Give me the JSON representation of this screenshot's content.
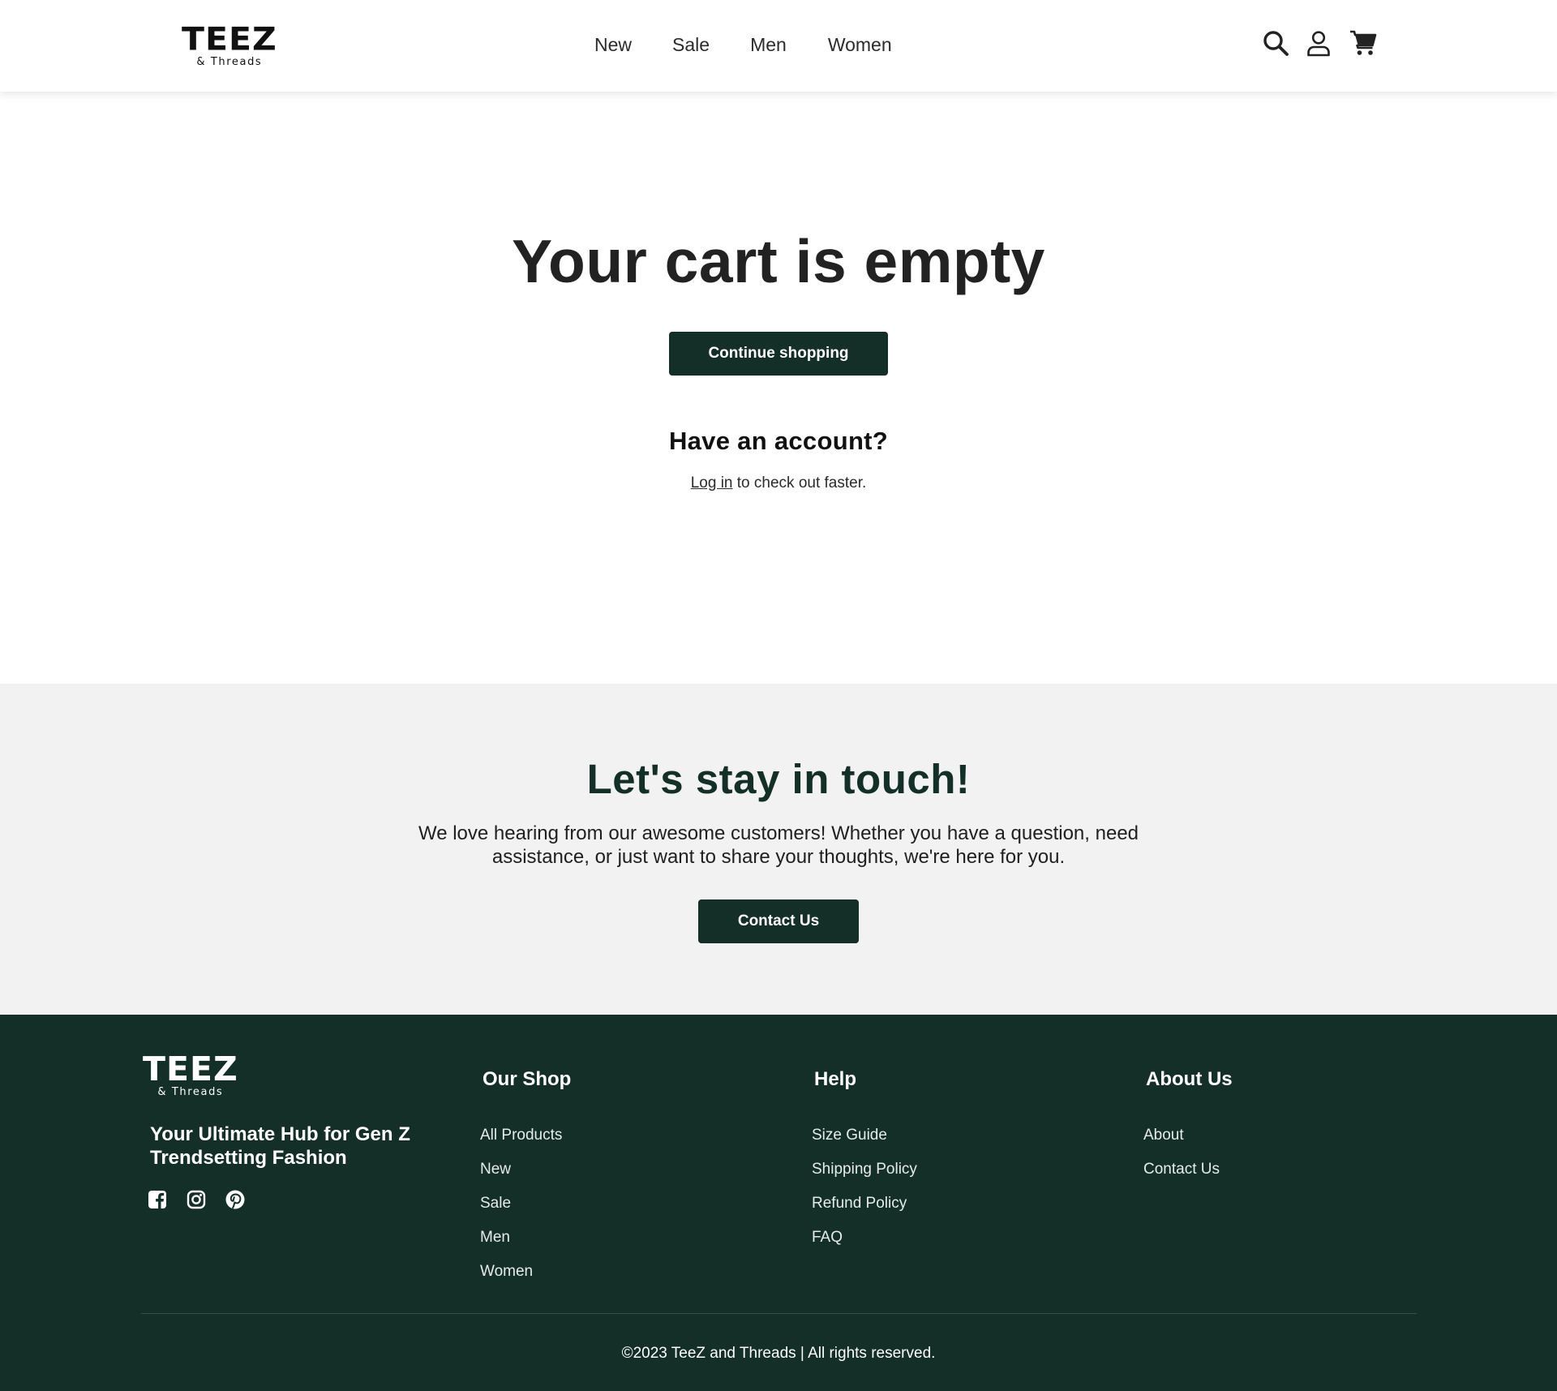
{
  "header": {
    "logo": {
      "brand": "TEEZ",
      "sub": "& Threads"
    },
    "nav": [
      "New",
      "Sale",
      "Men",
      "Women"
    ],
    "icons": [
      "search-icon",
      "account-icon",
      "cart-icon"
    ]
  },
  "main": {
    "title": "Your cart is empty",
    "continue_label": "Continue shopping",
    "account_title": "Have an account?",
    "login_link": "Log in",
    "login_suffix": " to check out faster."
  },
  "touch": {
    "title": "Let's stay in touch!",
    "text": "We love hearing from our awesome customers! Whether you have a question, need assistance, or just want to share your thoughts, we're here for you.",
    "contact_label": "Contact Us"
  },
  "footer": {
    "logo": {
      "brand": "TEEZ",
      "sub": "& Threads"
    },
    "tagline": "Your Ultimate Hub for Gen Z Trendsetting Fashion",
    "socials": [
      "facebook-icon",
      "instagram-icon",
      "pinterest-icon"
    ],
    "columns": [
      {
        "title": "Our Shop",
        "links": [
          "All Products",
          "New",
          "Sale",
          "Men",
          "Women"
        ]
      },
      {
        "title": "Help",
        "links": [
          "Size Guide",
          "Shipping Policy",
          "Refund Policy",
          "FAQ"
        ]
      },
      {
        "title": "About Us",
        "links": [
          "About",
          "Contact Us"
        ]
      }
    ],
    "copyright": "©2023 TeeZ and Threads | All rights reserved."
  },
  "colors": {
    "primary": "#142f27",
    "touch_bg": "#f2f2f2",
    "text": "#222222"
  }
}
